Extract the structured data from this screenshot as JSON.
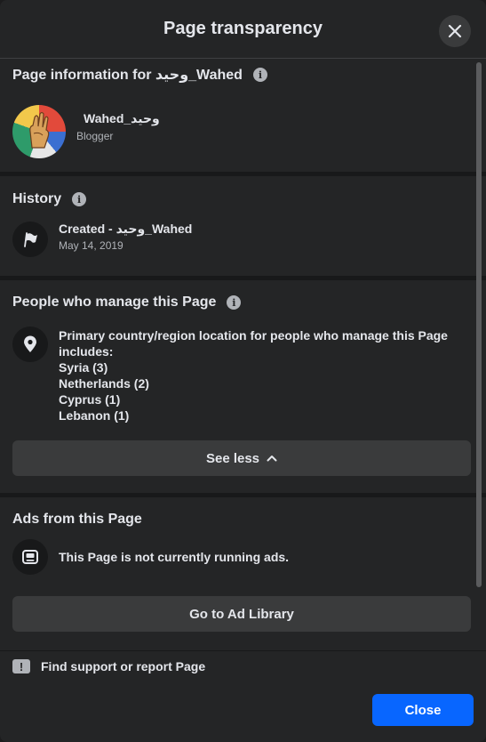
{
  "dialog": {
    "title": "Page transparency",
    "close_icon": "close-icon"
  },
  "page_info": {
    "title": "Page information for وحيد_Wahed",
    "page_name": "Wahed_وحيد",
    "category": "Blogger"
  },
  "history": {
    "title": "History",
    "event": "Created - وحيد_Wahed",
    "date": "May 14, 2019",
    "icon": "flag-icon"
  },
  "managers": {
    "title": "People who manage this Page",
    "description": "Primary country/region location for people who manage this Page includes:",
    "countries": [
      "Syria (3)",
      "Netherlands (2)",
      "Cyprus (1)",
      "Lebanon (1)"
    ],
    "see_less_label": "See less",
    "icon": "location-pin-icon"
  },
  "ads": {
    "title": "Ads from this Page",
    "status": "This Page is not currently running ads.",
    "ad_library_label": "Go to Ad Library",
    "icon": "ad-library-icon"
  },
  "footer": {
    "report_label": "Find support or report Page",
    "close_label": "Close"
  },
  "colors": {
    "background": "#242526",
    "button": "#3a3b3c",
    "primary_button": "#0866ff",
    "text": "#e4e6eb",
    "secondary_text": "#b0b3b8"
  }
}
